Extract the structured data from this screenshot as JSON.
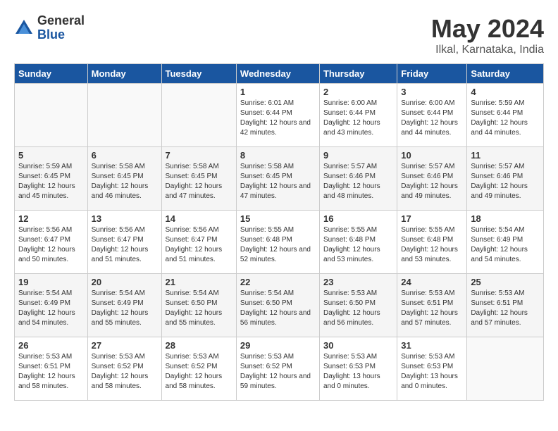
{
  "logo": {
    "general": "General",
    "blue": "Blue"
  },
  "title": "May 2024",
  "subtitle": "Ilkal, Karnataka, India",
  "days_header": [
    "Sunday",
    "Monday",
    "Tuesday",
    "Wednesday",
    "Thursday",
    "Friday",
    "Saturday"
  ],
  "weeks": [
    [
      {
        "day": "",
        "sunrise": "",
        "sunset": "",
        "daylight": ""
      },
      {
        "day": "",
        "sunrise": "",
        "sunset": "",
        "daylight": ""
      },
      {
        "day": "",
        "sunrise": "",
        "sunset": "",
        "daylight": ""
      },
      {
        "day": "1",
        "sunrise": "Sunrise: 6:01 AM",
        "sunset": "Sunset: 6:44 PM",
        "daylight": "Daylight: 12 hours and 42 minutes."
      },
      {
        "day": "2",
        "sunrise": "Sunrise: 6:00 AM",
        "sunset": "Sunset: 6:44 PM",
        "daylight": "Daylight: 12 hours and 43 minutes."
      },
      {
        "day": "3",
        "sunrise": "Sunrise: 6:00 AM",
        "sunset": "Sunset: 6:44 PM",
        "daylight": "Daylight: 12 hours and 44 minutes."
      },
      {
        "day": "4",
        "sunrise": "Sunrise: 5:59 AM",
        "sunset": "Sunset: 6:44 PM",
        "daylight": "Daylight: 12 hours and 44 minutes."
      }
    ],
    [
      {
        "day": "5",
        "sunrise": "Sunrise: 5:59 AM",
        "sunset": "Sunset: 6:45 PM",
        "daylight": "Daylight: 12 hours and 45 minutes."
      },
      {
        "day": "6",
        "sunrise": "Sunrise: 5:58 AM",
        "sunset": "Sunset: 6:45 PM",
        "daylight": "Daylight: 12 hours and 46 minutes."
      },
      {
        "day": "7",
        "sunrise": "Sunrise: 5:58 AM",
        "sunset": "Sunset: 6:45 PM",
        "daylight": "Daylight: 12 hours and 47 minutes."
      },
      {
        "day": "8",
        "sunrise": "Sunrise: 5:58 AM",
        "sunset": "Sunset: 6:45 PM",
        "daylight": "Daylight: 12 hours and 47 minutes."
      },
      {
        "day": "9",
        "sunrise": "Sunrise: 5:57 AM",
        "sunset": "Sunset: 6:46 PM",
        "daylight": "Daylight: 12 hours and 48 minutes."
      },
      {
        "day": "10",
        "sunrise": "Sunrise: 5:57 AM",
        "sunset": "Sunset: 6:46 PM",
        "daylight": "Daylight: 12 hours and 49 minutes."
      },
      {
        "day": "11",
        "sunrise": "Sunrise: 5:57 AM",
        "sunset": "Sunset: 6:46 PM",
        "daylight": "Daylight: 12 hours and 49 minutes."
      }
    ],
    [
      {
        "day": "12",
        "sunrise": "Sunrise: 5:56 AM",
        "sunset": "Sunset: 6:47 PM",
        "daylight": "Daylight: 12 hours and 50 minutes."
      },
      {
        "day": "13",
        "sunrise": "Sunrise: 5:56 AM",
        "sunset": "Sunset: 6:47 PM",
        "daylight": "Daylight: 12 hours and 51 minutes."
      },
      {
        "day": "14",
        "sunrise": "Sunrise: 5:56 AM",
        "sunset": "Sunset: 6:47 PM",
        "daylight": "Daylight: 12 hours and 51 minutes."
      },
      {
        "day": "15",
        "sunrise": "Sunrise: 5:55 AM",
        "sunset": "Sunset: 6:48 PM",
        "daylight": "Daylight: 12 hours and 52 minutes."
      },
      {
        "day": "16",
        "sunrise": "Sunrise: 5:55 AM",
        "sunset": "Sunset: 6:48 PM",
        "daylight": "Daylight: 12 hours and 53 minutes."
      },
      {
        "day": "17",
        "sunrise": "Sunrise: 5:55 AM",
        "sunset": "Sunset: 6:48 PM",
        "daylight": "Daylight: 12 hours and 53 minutes."
      },
      {
        "day": "18",
        "sunrise": "Sunrise: 5:54 AM",
        "sunset": "Sunset: 6:49 PM",
        "daylight": "Daylight: 12 hours and 54 minutes."
      }
    ],
    [
      {
        "day": "19",
        "sunrise": "Sunrise: 5:54 AM",
        "sunset": "Sunset: 6:49 PM",
        "daylight": "Daylight: 12 hours and 54 minutes."
      },
      {
        "day": "20",
        "sunrise": "Sunrise: 5:54 AM",
        "sunset": "Sunset: 6:49 PM",
        "daylight": "Daylight: 12 hours and 55 minutes."
      },
      {
        "day": "21",
        "sunrise": "Sunrise: 5:54 AM",
        "sunset": "Sunset: 6:50 PM",
        "daylight": "Daylight: 12 hours and 55 minutes."
      },
      {
        "day": "22",
        "sunrise": "Sunrise: 5:54 AM",
        "sunset": "Sunset: 6:50 PM",
        "daylight": "Daylight: 12 hours and 56 minutes."
      },
      {
        "day": "23",
        "sunrise": "Sunrise: 5:53 AM",
        "sunset": "Sunset: 6:50 PM",
        "daylight": "Daylight: 12 hours and 56 minutes."
      },
      {
        "day": "24",
        "sunrise": "Sunrise: 5:53 AM",
        "sunset": "Sunset: 6:51 PM",
        "daylight": "Daylight: 12 hours and 57 minutes."
      },
      {
        "day": "25",
        "sunrise": "Sunrise: 5:53 AM",
        "sunset": "Sunset: 6:51 PM",
        "daylight": "Daylight: 12 hours and 57 minutes."
      }
    ],
    [
      {
        "day": "26",
        "sunrise": "Sunrise: 5:53 AM",
        "sunset": "Sunset: 6:51 PM",
        "daylight": "Daylight: 12 hours and 58 minutes."
      },
      {
        "day": "27",
        "sunrise": "Sunrise: 5:53 AM",
        "sunset": "Sunset: 6:52 PM",
        "daylight": "Daylight: 12 hours and 58 minutes."
      },
      {
        "day": "28",
        "sunrise": "Sunrise: 5:53 AM",
        "sunset": "Sunset: 6:52 PM",
        "daylight": "Daylight: 12 hours and 58 minutes."
      },
      {
        "day": "29",
        "sunrise": "Sunrise: 5:53 AM",
        "sunset": "Sunset: 6:52 PM",
        "daylight": "Daylight: 12 hours and 59 minutes."
      },
      {
        "day": "30",
        "sunrise": "Sunrise: 5:53 AM",
        "sunset": "Sunset: 6:53 PM",
        "daylight": "Daylight: 13 hours and 0 minutes."
      },
      {
        "day": "31",
        "sunrise": "Sunrise: 5:53 AM",
        "sunset": "Sunset: 6:53 PM",
        "daylight": "Daylight: 13 hours and 0 minutes."
      },
      {
        "day": "",
        "sunrise": "",
        "sunset": "",
        "daylight": ""
      }
    ]
  ]
}
